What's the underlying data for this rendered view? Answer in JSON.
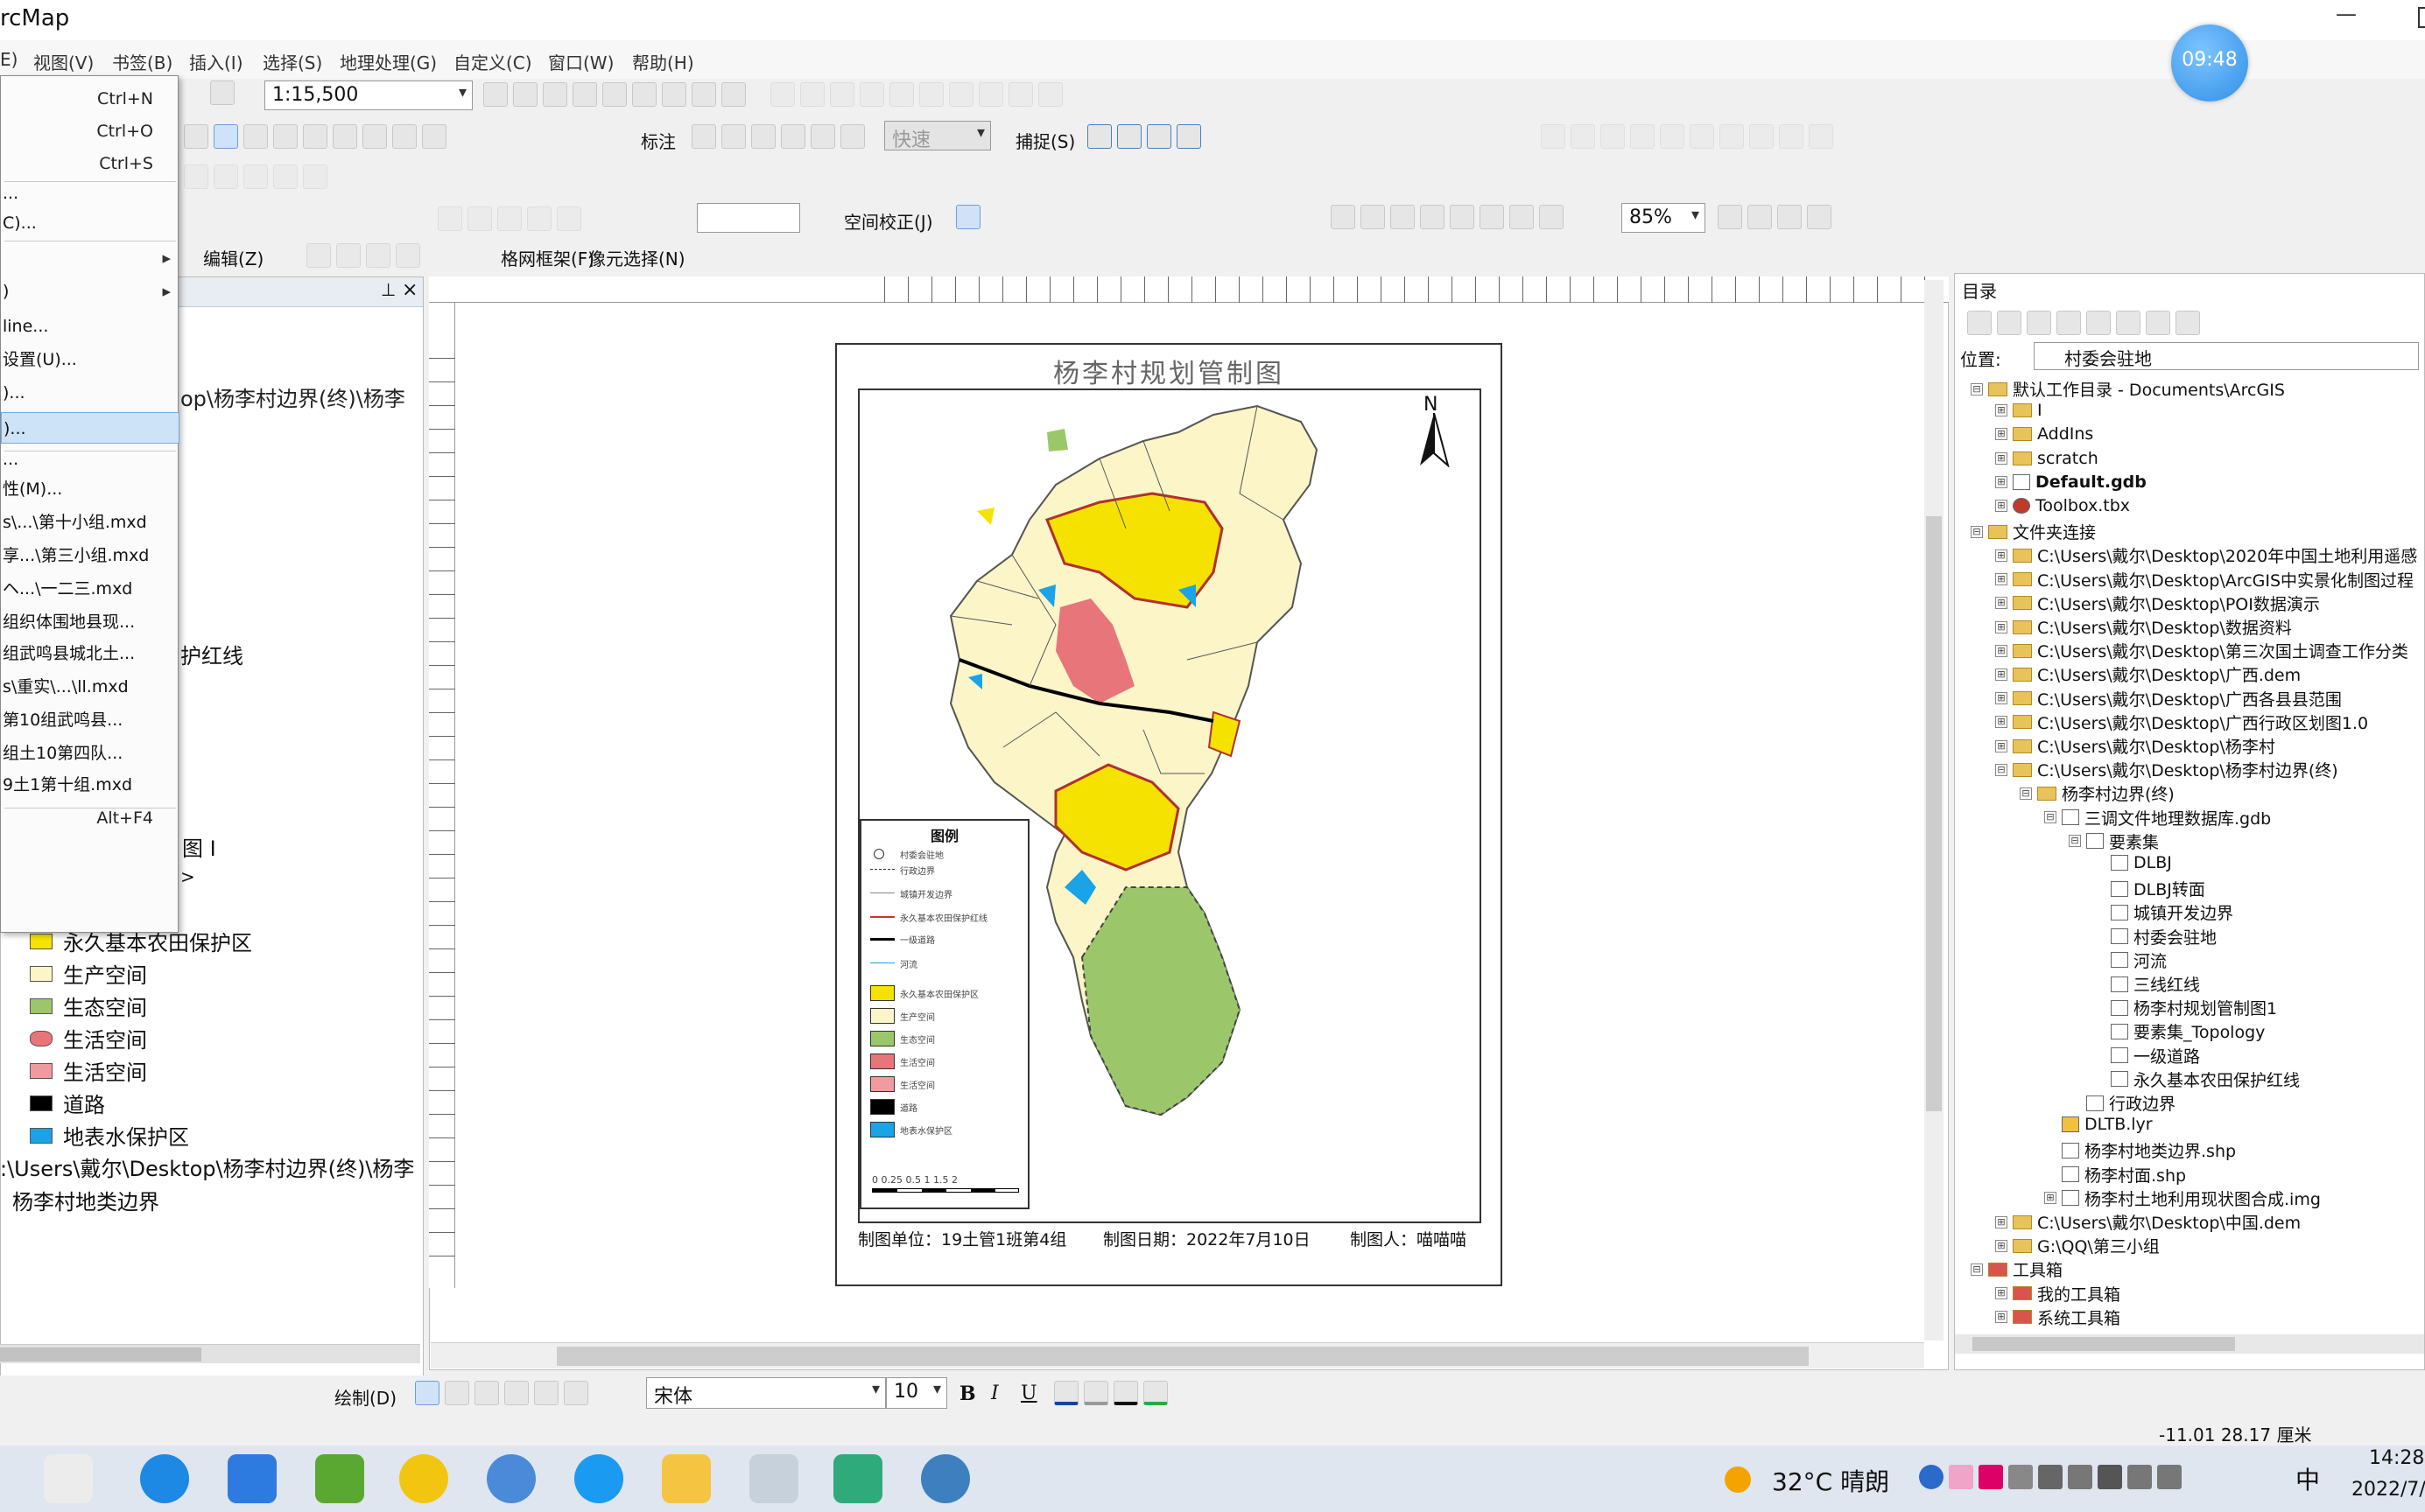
{
  "app": {
    "title": "rcMap",
    "clock_badge": "09:48",
    "minimize": "—"
  },
  "menu": [
    "E)",
    "视图(V)",
    "书签(B)",
    "插入(I)",
    "选择(S)",
    "地理处理(G)",
    "自定义(C)",
    "窗口(W)",
    "帮助(H)"
  ],
  "toolbar": {
    "scale": "1:15,500",
    "label_menu": "标注",
    "editor_placeholder": "快速",
    "snap_menu": "捕捉(S)",
    "spatial_adjust": "空间校正(J)",
    "zoom": "85%",
    "draw_menu": "编辑(Z)",
    "grid_menu": "格网框架(F)",
    "georef_menu": "像元选择(N)",
    "drawing_menu": "绘制(D)",
    "font_name": "宋体",
    "font_size": "10",
    "bold": "B",
    "italic": "I",
    "underline": "U"
  },
  "file_menu": {
    "items": [
      {
        "label": "",
        "shortcut": "Ctrl+N"
      },
      {
        "label": "",
        "shortcut": "Ctrl+O"
      },
      {
        "label": "",
        "shortcut": "Ctrl+S"
      },
      {
        "label": "..."
      },
      {
        "label": "C)..."
      },
      {
        "label": "",
        "submenu": "▸"
      },
      {
        "label": ")",
        "submenu": "▸"
      },
      {
        "label": "line..."
      },
      {
        "label": "设置(U)..."
      },
      {
        "label": ")..."
      },
      {
        "label": ")...",
        "highlighted": true
      },
      {
        "label": "..."
      },
      {
        "label": "性(M)..."
      },
      {
        "label": "s\\...\\第十小组.mxd"
      },
      {
        "label": "享...\\第三小组.mxd"
      },
      {
        "label": "ヘ...\\一二三.mxd"
      },
      {
        "label": "组织体围地县现..."
      },
      {
        "label": "组武鸣县城北土..."
      },
      {
        "label": "s\\重实\\...\\ll.mxd"
      },
      {
        "label": "第10组武鸣县..."
      },
      {
        "label": "组土10第四队..."
      },
      {
        "label": "9土1第十组.mxd"
      },
      {
        "label": "",
        "shortcut": "Alt+F4"
      }
    ]
  },
  "toc": {
    "pin": "⊥",
    "close": "×",
    "path_line": "op\\杨李村边界(终)\\杨李",
    "frag_protect": "护红线",
    "frag_mapname": "图 I",
    "frag_arrow": ">",
    "legend": [
      {
        "label": "永久基本农田保护区",
        "color": "#f5e200"
      },
      {
        "label": "生产空间",
        "color": "#fbf5c8"
      },
      {
        "label": "生态空间",
        "color": "#9bc76a"
      },
      {
        "label": "生活空间",
        "color": "#e7757a"
      },
      {
        "label": "生活空间",
        "color": "#f19ba0"
      },
      {
        "label": "道路",
        "color": "#000000"
      },
      {
        "label": "地表水保护区",
        "color": "#1aa3e6"
      }
    ],
    "path2": ":\\Users\\戴尔\\Desktop\\杨李村边界(终)\\杨李",
    "layer2": "杨李村地类边界"
  },
  "map": {
    "title": "杨李村规划管制图",
    "north": "N",
    "legend_title": "图例",
    "legend_items": [
      "村委会驻地",
      "行政边界",
      "城镇开发边界",
      "永久基本农田保护红线",
      "一级道路",
      "河流",
      "永久基本农田保护区",
      "生产空间",
      "生态空间",
      "生活空间",
      "生活空间",
      "道路",
      "地表水保护区"
    ],
    "footer_unit": "制图单位：19土管1班第4组",
    "footer_date": "制图日期：2022年7月10日",
    "footer_author": "制图人：喵喵喵",
    "scale_text": "0 0.25 0.5 1 1.5 2"
  },
  "catalog": {
    "title": "目录",
    "location_label": "位置:",
    "location_value": "村委会驻地",
    "rows": [
      {
        "indent": 0,
        "exp": "⊟",
        "icon": "fold",
        "label": "默认工作目录 - Documents\\ArcGIS"
      },
      {
        "indent": 1,
        "exp": "⊞",
        "icon": "fold",
        "label": "I"
      },
      {
        "indent": 1,
        "exp": "⊞",
        "icon": "fold",
        "label": "AddIns"
      },
      {
        "indent": 1,
        "exp": "⊞",
        "icon": "fold",
        "label": "scratch"
      },
      {
        "indent": 1,
        "exp": "⊞",
        "icon": "gdb",
        "label": "Default.gdb",
        "bold": true
      },
      {
        "indent": 1,
        "exp": "⊞",
        "icon": "tbx",
        "label": "Toolbox.tbx"
      },
      {
        "indent": 0,
        "exp": "⊟",
        "icon": "fold",
        "label": "文件夹连接"
      },
      {
        "indent": 1,
        "exp": "⊞",
        "icon": "fold",
        "label": "C:\\Users\\戴尔\\Desktop\\2020年中国土地利用遥感"
      },
      {
        "indent": 1,
        "exp": "⊞",
        "icon": "fold",
        "label": "C:\\Users\\戴尔\\Desktop\\ArcGIS中实景化制图过程"
      },
      {
        "indent": 1,
        "exp": "⊞",
        "icon": "fold",
        "label": "C:\\Users\\戴尔\\Desktop\\POI数据演示"
      },
      {
        "indent": 1,
        "exp": "⊞",
        "icon": "fold",
        "label": "C:\\Users\\戴尔\\Desktop\\数据资料"
      },
      {
        "indent": 1,
        "exp": "⊞",
        "icon": "fold",
        "label": "C:\\Users\\戴尔\\Desktop\\第三次国土调查工作分类"
      },
      {
        "indent": 1,
        "exp": "⊞",
        "icon": "fold",
        "label": "C:\\Users\\戴尔\\Desktop\\广西.dem"
      },
      {
        "indent": 1,
        "exp": "⊞",
        "icon": "fold",
        "label": "C:\\Users\\戴尔\\Desktop\\广西各县县范围"
      },
      {
        "indent": 1,
        "exp": "⊞",
        "icon": "fold",
        "label": "C:\\Users\\戴尔\\Desktop\\广西行政区划图1.0"
      },
      {
        "indent": 1,
        "exp": "⊞",
        "icon": "fold",
        "label": "C:\\Users\\戴尔\\Desktop\\杨李村"
      },
      {
        "indent": 1,
        "exp": "⊟",
        "icon": "fold",
        "label": "C:\\Users\\戴尔\\Desktop\\杨李村边界(终)"
      },
      {
        "indent": 2,
        "exp": "⊟",
        "icon": "fold",
        "label": "杨李村边界(终)"
      },
      {
        "indent": 3,
        "exp": "⊟",
        "icon": "gdb",
        "label": "三调文件地理数据库.gdb"
      },
      {
        "indent": 4,
        "exp": "⊟",
        "icon": "lyr",
        "label": "要素集"
      },
      {
        "indent": 5,
        "exp": "",
        "icon": "lyr",
        "label": "DLBJ"
      },
      {
        "indent": 5,
        "exp": "",
        "icon": "lyr",
        "label": "DLBJ转面"
      },
      {
        "indent": 5,
        "exp": "",
        "icon": "lyr",
        "label": "城镇开发边界"
      },
      {
        "indent": 5,
        "exp": "",
        "icon": "lyr",
        "label": "村委会驻地"
      },
      {
        "indent": 5,
        "exp": "",
        "icon": "lyr",
        "label": "河流"
      },
      {
        "indent": 5,
        "exp": "",
        "icon": "lyr",
        "label": "三线红线"
      },
      {
        "indent": 5,
        "exp": "",
        "icon": "lyr",
        "label": "杨李村规划管制图1"
      },
      {
        "indent": 5,
        "exp": "",
        "icon": "lyr",
        "label": "要素集_Topology"
      },
      {
        "indent": 5,
        "exp": "",
        "icon": "lyr",
        "label": "一级道路"
      },
      {
        "indent": 5,
        "exp": "",
        "icon": "lyr",
        "label": "永久基本农田保护红线"
      },
      {
        "indent": 4,
        "exp": "",
        "icon": "lyr",
        "label": "行政边界"
      },
      {
        "indent": 3,
        "exp": "",
        "icon": "lyrf",
        "label": "DLTB.lyr"
      },
      {
        "indent": 3,
        "exp": "",
        "icon": "lyr",
        "label": "杨李村地类边界.shp"
      },
      {
        "indent": 3,
        "exp": "",
        "icon": "lyr",
        "label": "杨李村面.shp"
      },
      {
        "indent": 3,
        "exp": "⊞",
        "icon": "lyr",
        "label": "杨李村土地利用现状图合成.img"
      },
      {
        "indent": 1,
        "exp": "⊞",
        "icon": "fold",
        "label": "C:\\Users\\戴尔\\Desktop\\中国.dem"
      },
      {
        "indent": 1,
        "exp": "⊞",
        "icon": "fold",
        "label": "G:\\QQ\\第三小组"
      },
      {
        "indent": 0,
        "exp": "⊟",
        "icon": "tool",
        "label": "工具箱"
      },
      {
        "indent": 1,
        "exp": "⊞",
        "icon": "tool",
        "label": "我的工具箱"
      },
      {
        "indent": 1,
        "exp": "⊞",
        "icon": "tool",
        "label": "系统工具箱"
      }
    ]
  },
  "status": {
    "coords": "-11.01  28.17 厘米"
  },
  "taskbar": {
    "weather": "32°C 晴朗",
    "ime": "中",
    "time": "14:28",
    "date": "2022/7/"
  },
  "colors": {
    "accent": "#2f8fe6",
    "selection": "#cde3f8"
  }
}
